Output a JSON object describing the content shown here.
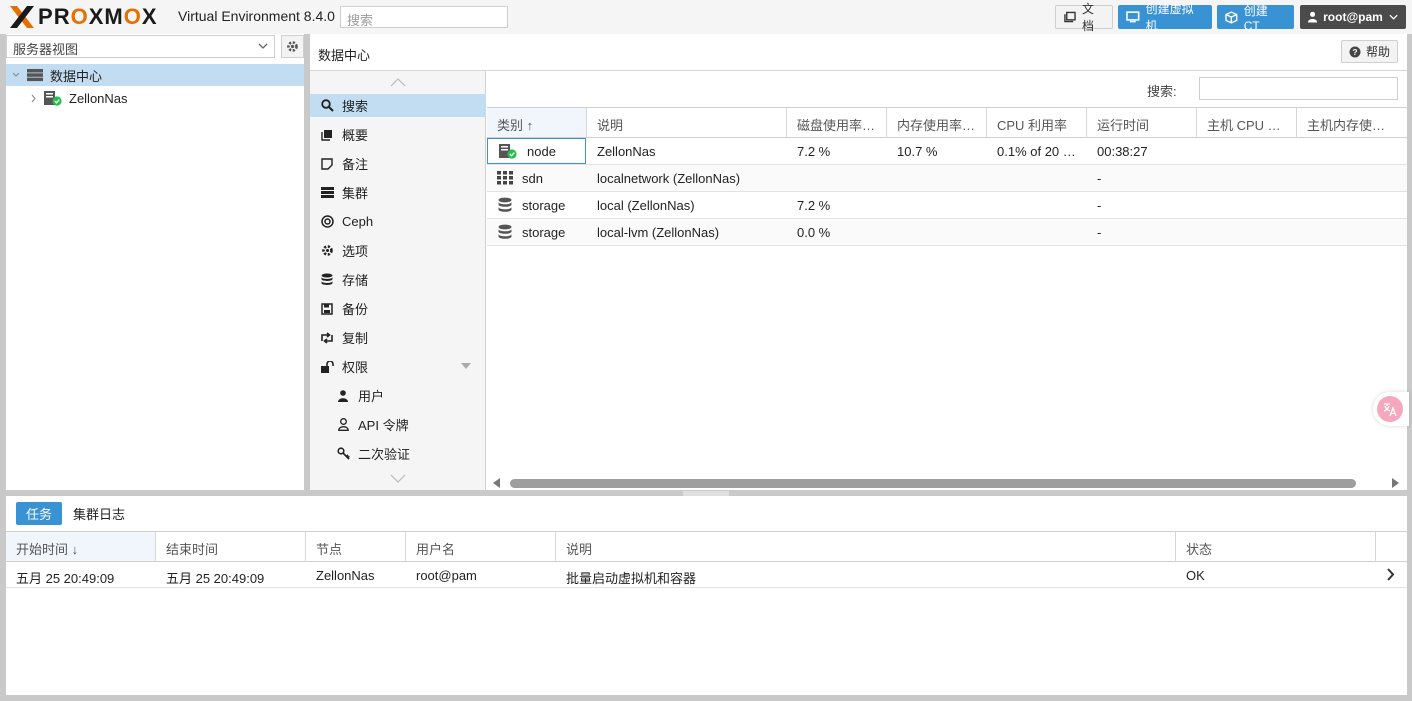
{
  "header": {
    "brand": "PROXMOX",
    "version": "Virtual Environment 8.4.0",
    "search_placeholder": "搜索",
    "docs_label": "文档",
    "create_vm_label": "创建虚拟机",
    "create_ct_label": "创建 CT",
    "user_label": "root@pam"
  },
  "tree": {
    "view_label": "服务器视图",
    "root_label": "数据中心",
    "node_label": "ZellonNas"
  },
  "content": {
    "title": "数据中心",
    "help_label": "帮助",
    "search_label": "搜索:"
  },
  "nav": {
    "items": [
      {
        "label": "搜索",
        "icon": "search-icon"
      },
      {
        "label": "概要",
        "icon": "book-icon"
      },
      {
        "label": "备注",
        "icon": "note-icon"
      },
      {
        "label": "集群",
        "icon": "server-icon"
      },
      {
        "label": "Ceph",
        "icon": "ceph-icon"
      },
      {
        "label": "选项",
        "icon": "gear-icon"
      },
      {
        "label": "存储",
        "icon": "database-icon"
      },
      {
        "label": "备份",
        "icon": "floppy-icon"
      },
      {
        "label": "复制",
        "icon": "retweet-icon"
      },
      {
        "label": "权限",
        "icon": "unlock-icon"
      },
      {
        "label": "用户",
        "icon": "user-icon"
      },
      {
        "label": "API 令牌",
        "icon": "user-outline-icon"
      },
      {
        "label": "二次验证",
        "icon": "key-icon"
      }
    ]
  },
  "grid": {
    "columns": [
      "类别 ↑",
      "说明",
      "磁盘使用率…",
      "内存使用率…",
      "CPU 利用率",
      "运行时间",
      "主机 CPU …",
      "主机内存使…"
    ],
    "rows": [
      {
        "type": "node",
        "desc": "ZellonNas",
        "disk": "7.2 %",
        "mem": "10.7 %",
        "cpu": "0.1% of 20 …",
        "uptime": "00:38:27"
      },
      {
        "type": "sdn",
        "desc": "localnetwork (ZellonNas)",
        "disk": "",
        "mem": "",
        "cpu": "",
        "uptime": "-"
      },
      {
        "type": "storage",
        "desc": "local (ZellonNas)",
        "disk": "7.2 %",
        "mem": "",
        "cpu": "",
        "uptime": "-"
      },
      {
        "type": "storage",
        "desc": "local-lvm (ZellonNas)",
        "disk": "0.0 %",
        "mem": "",
        "cpu": "",
        "uptime": "-"
      }
    ]
  },
  "bottom": {
    "tabs": [
      "任务",
      "集群日志"
    ],
    "columns": [
      "开始时间 ↓",
      "结束时间",
      "节点",
      "用户名",
      "说明",
      "状态"
    ],
    "rows": [
      {
        "start": "五月 25 20:49:09",
        "end": "五月 25 20:49:09",
        "node": "ZellonNas",
        "user": "root@pam",
        "desc": "批量启动虚拟机和容器",
        "status": "OK"
      }
    ]
  },
  "colors": {
    "accent": "#3892d4",
    "selection": "#c2ddf2",
    "brand_orange": "#e57000",
    "ok_green": "#21bf4b"
  }
}
